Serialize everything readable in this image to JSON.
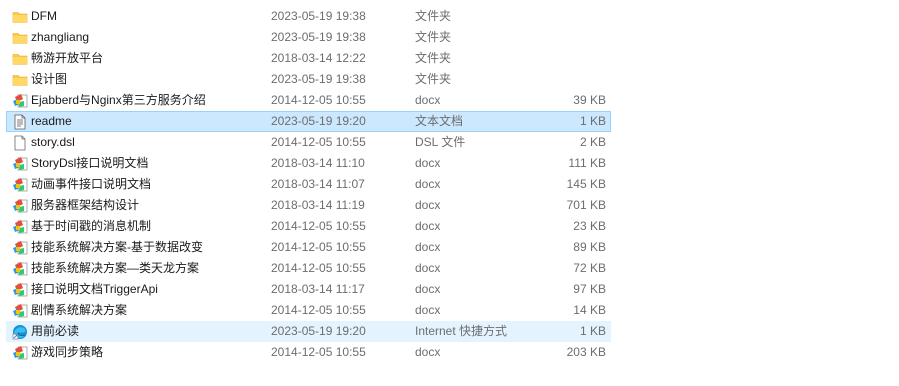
{
  "files": [
    {
      "name": "DFM",
      "date": "2023-05-19 19:38",
      "type": "文件夹",
      "size": "",
      "icon": "folder-icon",
      "state": ""
    },
    {
      "name": "zhangliang",
      "date": "2023-05-19 19:38",
      "type": "文件夹",
      "size": "",
      "icon": "folder-icon",
      "state": ""
    },
    {
      "name": "畅游开放平台",
      "date": "2018-03-14 12:22",
      "type": "文件夹",
      "size": "",
      "icon": "folder-icon",
      "state": ""
    },
    {
      "name": "设计图",
      "date": "2023-05-19 19:38",
      "type": "文件夹",
      "size": "",
      "icon": "folder-icon",
      "state": ""
    },
    {
      "name": "Ejabberd与Nginx第三方服务介绍",
      "date": "2014-12-05 10:55",
      "type": "docx",
      "size": "39 KB",
      "icon": "docx-icon",
      "state": ""
    },
    {
      "name": "readme",
      "date": "2023-05-19 19:20",
      "type": "文本文档",
      "size": "1 KB",
      "icon": "text-file-icon",
      "state": "hovered"
    },
    {
      "name": "story.dsl",
      "date": "2014-12-05 10:55",
      "type": "DSL 文件",
      "size": "2 KB",
      "icon": "blank-file-icon",
      "state": ""
    },
    {
      "name": "StoryDsl接口说明文档",
      "date": "2018-03-14 11:10",
      "type": "docx",
      "size": "111 KB",
      "icon": "docx-icon",
      "state": ""
    },
    {
      "name": "动画事件接口说明文档",
      "date": "2018-03-14 11:07",
      "type": "docx",
      "size": "145 KB",
      "icon": "docx-icon",
      "state": ""
    },
    {
      "name": "服务器框架结构设计",
      "date": "2018-03-14 11:19",
      "type": "docx",
      "size": "701 KB",
      "icon": "docx-icon",
      "state": ""
    },
    {
      "name": "基于时间戳的消息机制",
      "date": "2014-12-05 10:55",
      "type": "docx",
      "size": "23 KB",
      "icon": "docx-icon",
      "state": ""
    },
    {
      "name": "技能系统解决方案-基于数据改变",
      "date": "2014-12-05 10:55",
      "type": "docx",
      "size": "89 KB",
      "icon": "docx-icon",
      "state": ""
    },
    {
      "name": "技能系统解决方案—类天龙方案",
      "date": "2014-12-05 10:55",
      "type": "docx",
      "size": "72 KB",
      "icon": "docx-icon",
      "state": ""
    },
    {
      "name": "接口说明文档TriggerApi",
      "date": "2018-03-14 11:17",
      "type": "docx",
      "size": "97 KB",
      "icon": "docx-icon",
      "state": ""
    },
    {
      "name": "剧情系统解决方案",
      "date": "2014-12-05 10:55",
      "type": "docx",
      "size": "14 KB",
      "icon": "docx-icon",
      "state": ""
    },
    {
      "name": "用前必读",
      "date": "2023-05-19 19:20",
      "type": "Internet 快捷方式",
      "size": "1 KB",
      "icon": "edge-shortcut-icon",
      "state": "selected-light"
    },
    {
      "name": "游戏同步策略",
      "date": "2014-12-05 10:55",
      "type": "docx",
      "size": "203 KB",
      "icon": "docx-icon",
      "state": ""
    }
  ],
  "colors": {
    "folder": "#ffc83d",
    "hover_bg": "#cce8ff",
    "hover_border": "#99d1ff",
    "select_bg": "#e5f3ff"
  }
}
